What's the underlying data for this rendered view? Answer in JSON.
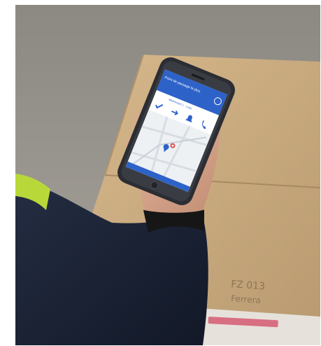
{
  "photo": {
    "subject": "hand holding smartphone with delivery app over cardboard box",
    "colors": {
      "border": "#ffffff",
      "background_floor": "#9a978f",
      "cardboard": "#c9a97e",
      "jacket": "#1c2436",
      "sleeve_stripe": "#b8d83a",
      "skin": "#d7a58a",
      "phone_frame": "#2b2d33",
      "app_header": "#2d62c8",
      "app_toolbar": "#ffffff",
      "map": "#eef1f4",
      "label_sheet": "#e6e2db",
      "label_stripe": "#d86e82"
    }
  },
  "phone": {
    "app_title": "Point de passage le plus",
    "app_subtitle": "",
    "status_chip": "Maintenant 1 · Ludo",
    "actions": [
      {
        "icon": "check-icon",
        "label": ""
      },
      {
        "icon": "arrow-icon",
        "label": ""
      },
      {
        "icon": "bell-icon",
        "label": ""
      },
      {
        "icon": "phone-icon",
        "label": ""
      }
    ]
  }
}
